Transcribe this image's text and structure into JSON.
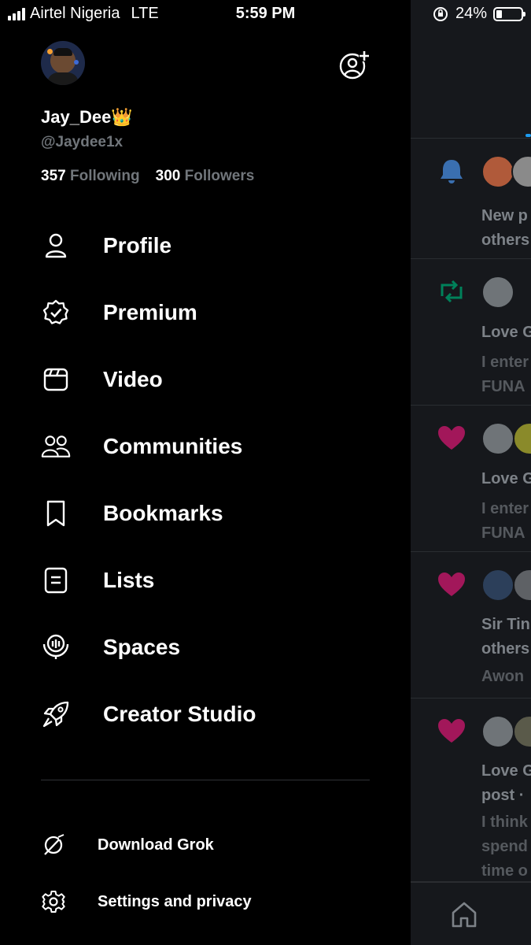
{
  "status_bar": {
    "carrier": "Airtel Nigeria",
    "network": "LTE",
    "time": "5:59 PM",
    "battery_percent": "24%",
    "battery_level": 0.24
  },
  "profile": {
    "display_name": "Jay_Dee👑",
    "handle": "@Jaydee1x",
    "following_count": "357",
    "following_label": "Following",
    "followers_count": "300",
    "followers_label": "Followers"
  },
  "menu": [
    {
      "label": "Profile",
      "icon": "person-icon"
    },
    {
      "label": "Premium",
      "icon": "verified-badge-icon"
    },
    {
      "label": "Video",
      "icon": "video-clapper-icon"
    },
    {
      "label": "Communities",
      "icon": "communities-icon"
    },
    {
      "label": "Bookmarks",
      "icon": "bookmark-icon"
    },
    {
      "label": "Lists",
      "icon": "list-icon"
    },
    {
      "label": "Spaces",
      "icon": "spaces-mic-icon"
    },
    {
      "label": "Creator Studio",
      "icon": "rocket-icon"
    }
  ],
  "secondary_menu": [
    {
      "label": "Download Grok",
      "icon": "grok-icon"
    },
    {
      "label": "Settings and privacy",
      "icon": "gear-icon"
    }
  ],
  "background_notifications": [
    {
      "type": "bell-icon",
      "lines": [
        "New p",
        "others"
      ]
    },
    {
      "type": "repost-icon",
      "lines": [
        "Love G"
      ],
      "sub_lines": [
        "I enter",
        "FUNA"
      ]
    },
    {
      "type": "heart-icon",
      "lines": [
        "Love G"
      ],
      "sub_lines": [
        "I enter",
        "FUNA"
      ]
    },
    {
      "type": "heart-icon",
      "lines": [
        "Sir Tin",
        "others"
      ],
      "sub_lines": [
        "Awon"
      ]
    },
    {
      "type": "heart-icon",
      "lines": [
        "Love G",
        "post ·"
      ],
      "sub_lines": [
        "I think",
        "spend",
        "time o"
      ]
    }
  ],
  "colors": {
    "accent": "#1d9bf0",
    "like": "#f91880",
    "repost": "#00ba7c",
    "bell": "#1d9bf0",
    "muted_text": "#71767b"
  }
}
